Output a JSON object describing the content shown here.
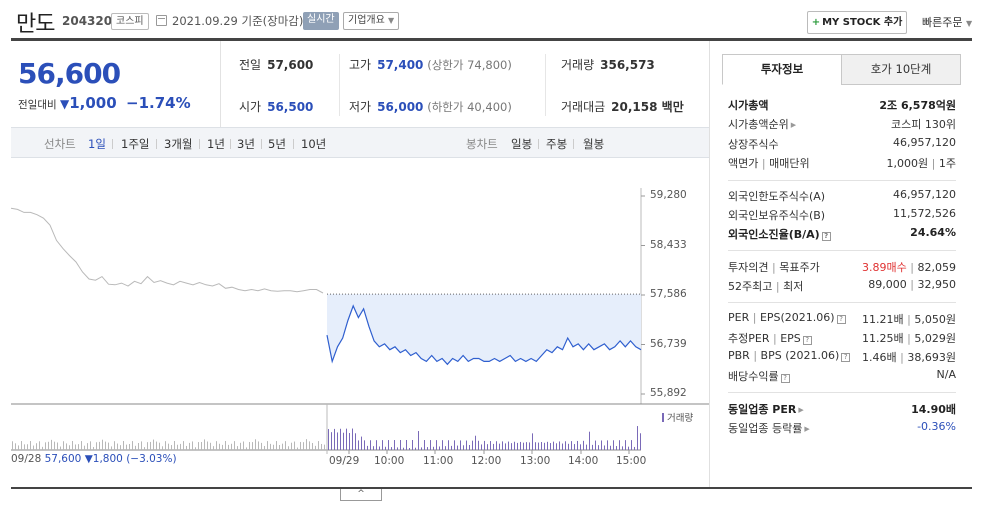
{
  "header": {
    "stock_name": "만도",
    "stock_code": "204320",
    "market_badge": "코스피",
    "date_text": "2021.09.29 기준(장마감)",
    "realtime_badge": "실시간",
    "corp_overview": "기업개요",
    "mystock_button": "MY STOCK 추가",
    "quick_order": "빠른주문"
  },
  "price": {
    "current": "56,600",
    "change_label": "전일대비",
    "change_value": "1,000",
    "change_pct": "−1.74%"
  },
  "quotes": {
    "prev_label": "전일",
    "prev_value": "57,600",
    "high_label": "고가",
    "high_value": "57,400",
    "high_limit": "(상한가 74,800)",
    "volume_label": "거래량",
    "volume_value": "356,573",
    "open_label": "시가",
    "open_value": "56,500",
    "low_label": "저가",
    "low_value": "56,000",
    "low_limit": "(하한가 40,400)",
    "amount_label": "거래대금",
    "amount_value": "20,158 백만"
  },
  "chart_tabs": {
    "line_label": "선차트",
    "periods": [
      "1일",
      "1주일",
      "3개월",
      "1년",
      "3년",
      "5년",
      "10년"
    ],
    "candle_label": "봉차트",
    "candles": [
      "일봉",
      "주봉",
      "월봉"
    ]
  },
  "chart_data": {
    "type": "line",
    "y_ticks": [
      "59,280",
      "58,433",
      "57,586",
      "56,739",
      "55,892"
    ],
    "ylim": [
      55892,
      59280
    ],
    "prev_close": 57600,
    "x_ticks": [
      "09/28",
      "09/29",
      "10:00",
      "11:00",
      "12:00",
      "13:00",
      "14:00",
      "15:00"
    ],
    "prev_day_values": [
      59070,
      59050,
      59000,
      59000,
      58960,
      58900,
      58780,
      58520,
      58380,
      58260,
      58150,
      57980,
      57860,
      57840,
      57900,
      57770,
      57760,
      57790,
      57740,
      57820,
      57780,
      57900,
      57800,
      57830,
      57790,
      57760,
      57820,
      57790,
      57760,
      57800,
      57760,
      57740,
      57780,
      57700,
      57720,
      57680,
      57660,
      57680,
      57660,
      57690,
      57660,
      57650,
      57660,
      57660,
      57640,
      57660,
      57680,
      57680,
      57620
    ],
    "today_values": [
      56900,
      56450,
      56700,
      56850,
      57150,
      57400,
      57200,
      57350,
      57050,
      56800,
      56700,
      56750,
      56650,
      56700,
      56600,
      56650,
      56550,
      56600,
      56500,
      56450,
      56550,
      56450,
      56500,
      56400,
      56500,
      56450,
      56550,
      56450,
      56500,
      56500,
      56450,
      56450,
      56500,
      56450,
      56500,
      56550,
      56450,
      56500,
      56450,
      56500,
      56450,
      56550,
      56650,
      56600,
      56700,
      56650,
      56850,
      56700,
      56750,
      56650,
      56750,
      56650,
      56700,
      56750,
      56650,
      56700,
      56800,
      56700,
      56800,
      56700,
      56650
    ],
    "prev_summary": {
      "date": "09/28",
      "close": "57,600",
      "change": "▼1,800",
      "pct": "(−3.03%)"
    },
    "volume_legend": "거래량"
  },
  "handle_glyph": "^",
  "side": {
    "tab_active": "투자정보",
    "tab_other": "호가 10단계",
    "market_cap_label": "시가총액",
    "market_cap_value": "2조 6,578억원",
    "cap_rank_label": "시가총액순위",
    "cap_rank_value": "코스피 130위",
    "shares_label": "상장주식수",
    "shares_value": "46,957,120",
    "face_label": "액면가",
    "face_label2": "매매단위",
    "face_value": "1,000원",
    "face_value2": "1주",
    "foreign_limit_label": "외국인한도주식수(A)",
    "foreign_limit_value": "46,957,120",
    "foreign_hold_label": "외국인보유주식수(B)",
    "foreign_hold_value": "11,572,526",
    "foreign_rate_label": "외국인소진율(B/A)",
    "foreign_rate_value": "24.64%",
    "opinion_label": "투자의견",
    "opinion_label2": "목표주가",
    "opinion_value": "3.89매수",
    "target_value": "82,059",
    "w52_label": "52주최고",
    "w52_label2": "최저",
    "w52_high": "89,000",
    "w52_low": "32,950",
    "per_label": "PER",
    "eps_label": "EPS(2021.06)",
    "per_value": "11.21배",
    "eps_value": "5,050원",
    "est_per_label": "추정PER",
    "est_eps_label": "EPS",
    "est_per_value": "11.25배",
    "est_eps_value": "5,029원",
    "pbr_label": "PBR",
    "bps_label": "BPS (2021.06)",
    "pbr_value": "1.46배",
    "bps_value": "38,693원",
    "div_label": "배당수익률",
    "div_value": "N/A",
    "sector_per_label": "동일업종 PER",
    "sector_per_value": "14.90배",
    "sector_rate_label": "동일업종 등락률",
    "sector_rate_value": "-0.36%",
    "info_glyph": "?"
  }
}
